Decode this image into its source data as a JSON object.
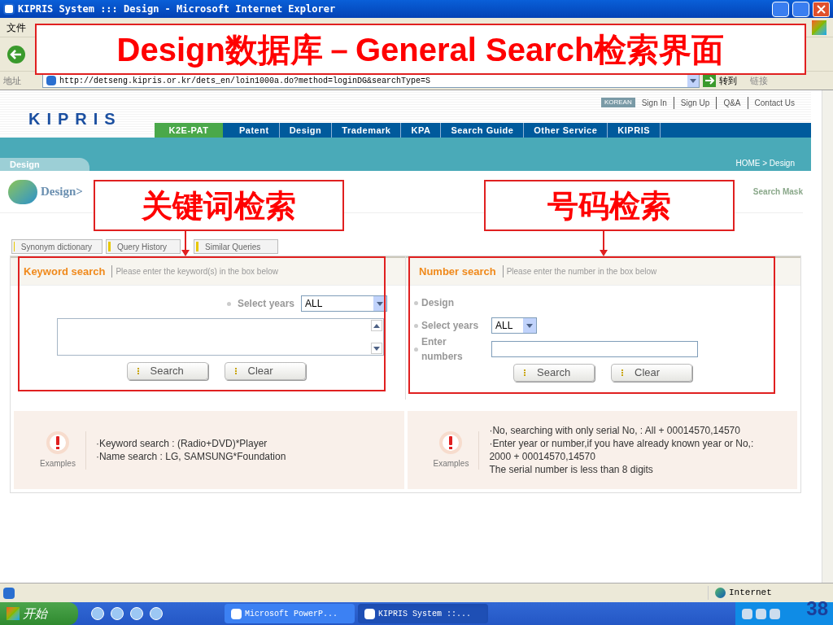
{
  "window": {
    "title": "KIPRIS System ::: Design - Microsoft Internet Explorer"
  },
  "menu_bar": {
    "items": [
      "文件"
    ]
  },
  "address_bar": {
    "label": "地址",
    "url": "http://detseng.kipris.or.kr/dets_en/loin1000a.do?method=loginDG&searchType=S",
    "go": "转到",
    "links": "链接"
  },
  "site": {
    "logo": "KIPRIS",
    "language": "KOREAN",
    "top_links": [
      "Sign In",
      "Sign Up",
      "Q&A",
      "Contact Us"
    ],
    "nav": [
      {
        "label": "K2E-PAT",
        "selected": true
      },
      {
        "label": "Patent",
        "selected": false
      },
      {
        "label": "Design",
        "selected": false
      },
      {
        "label": "Trademark",
        "selected": false
      },
      {
        "label": "KPA",
        "selected": false
      },
      {
        "label": "Search Guide",
        "selected": false
      },
      {
        "label": "Other Service",
        "selected": false
      },
      {
        "label": "KIPRIS",
        "selected": false
      }
    ],
    "section": "Design",
    "breadcrumb": "HOME > Design",
    "page_title": "Design>",
    "search_mask": "Search Mask",
    "tool_tabs": [
      "Synonym dictionary",
      "Query History",
      "Similar Queries"
    ]
  },
  "keyword_search": {
    "title": "Keyword search",
    "hint": "Please enter the keyword(s) in the box below",
    "years_label": "Select years",
    "years_value": "ALL",
    "buttons": [
      "Search",
      "Clear"
    ],
    "examples_label": "Examples",
    "examples": [
      "·Keyword search : (Radio+DVD)*Player",
      "·Name search : LG, SAMSUNG*Foundation"
    ]
  },
  "number_search": {
    "title": "Number search",
    "hint": "Please enter the number in the box below",
    "fields": [
      {
        "kind": "label",
        "label": "Design"
      },
      {
        "kind": "select",
        "label": "Select years",
        "value": "ALL"
      },
      {
        "kind": "input",
        "label": "Enter numbers"
      }
    ],
    "buttons": [
      "Search",
      "Clear"
    ],
    "examples_label": "Examples",
    "examples": [
      "·No, searching with only serial No, : All + 00014570,14570",
      "·Enter year or number,if you have already known year or No,: 2000 + 00014570,14570",
      "The serial number is less than 8 digits"
    ]
  },
  "status_bar": {
    "zone": "Internet"
  },
  "taskbar": {
    "start": "开始",
    "tasks": [
      {
        "label": "Microsoft PowerP...",
        "selected": false
      },
      {
        "label": "KIPRIS System ::...",
        "selected": true
      }
    ]
  },
  "annotations": {
    "title": "Design数据库－General Search检索界面",
    "callouts": [
      "关键词检索",
      "号码检索"
    ]
  },
  "slide_number": "38"
}
